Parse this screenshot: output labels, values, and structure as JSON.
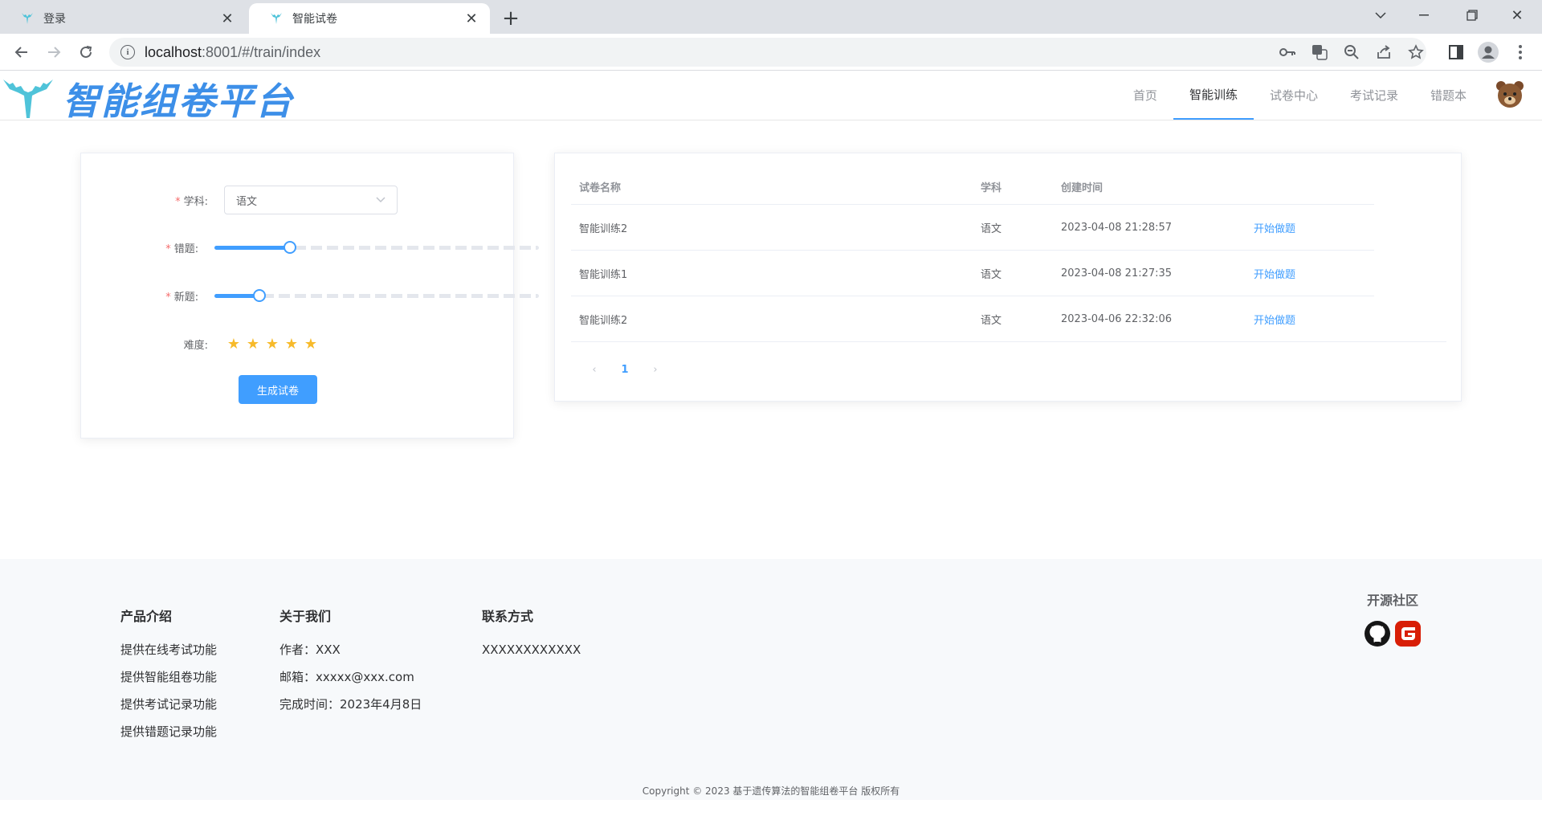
{
  "browser": {
    "tabs": [
      {
        "title": "登录",
        "active": false
      },
      {
        "title": "智能试卷",
        "active": true
      }
    ],
    "url_host": "localhost",
    "url_rest": ":8001/#/train/index"
  },
  "header": {
    "logo_text": "智能组卷平台",
    "nav": [
      "首页",
      "智能训练",
      "试卷中心",
      "考试记录",
      "错题本"
    ],
    "active_nav": "智能训练"
  },
  "form": {
    "subject_label": "学科:",
    "subject_value": "语文",
    "wrong_label": "错题:",
    "wrong_level": 0.25,
    "new_label": "新题:",
    "new_level": 0.15,
    "difficulty_label": "难度:",
    "difficulty_stars": 5,
    "generate_button": "生成试卷"
  },
  "table": {
    "columns": [
      "试卷名称",
      "学科",
      "创建时间"
    ],
    "rows": [
      {
        "name": "智能训练2",
        "subject": "语文",
        "created": "2023-04-08 21:28:57",
        "action": "开始做题"
      },
      {
        "name": "智能训练1",
        "subject": "语文",
        "created": "2023-04-08 21:27:35",
        "action": "开始做题"
      },
      {
        "name": "智能训练2",
        "subject": "语文",
        "created": "2023-04-06 22:32:06",
        "action": "开始做题"
      }
    ],
    "pagination": {
      "prev": "‹",
      "current": "1",
      "next": "›"
    }
  },
  "footer": {
    "product": {
      "title": "产品介绍",
      "items": [
        "提供在线考试功能",
        "提供智能组卷功能",
        "提供考试记录功能",
        "提供错题记录功能"
      ]
    },
    "about": {
      "title": "关于我们",
      "items": [
        "作者：XXX",
        "邮箱：xxxxx@xxx.com",
        "完成时间：2023年4月8日"
      ]
    },
    "contact": {
      "title": "联系方式",
      "items": [
        "XXXXXXXXXXXX"
      ]
    },
    "community": {
      "title": "开源社区"
    },
    "copyright": "Copyright © 2023 基于遗传算法的智能组卷平台 版权所有"
  },
  "colors": {
    "primary": "#409eff",
    "star": "#f7ba2a",
    "logo": "#3d8fe8",
    "required": "#f56c6c"
  }
}
